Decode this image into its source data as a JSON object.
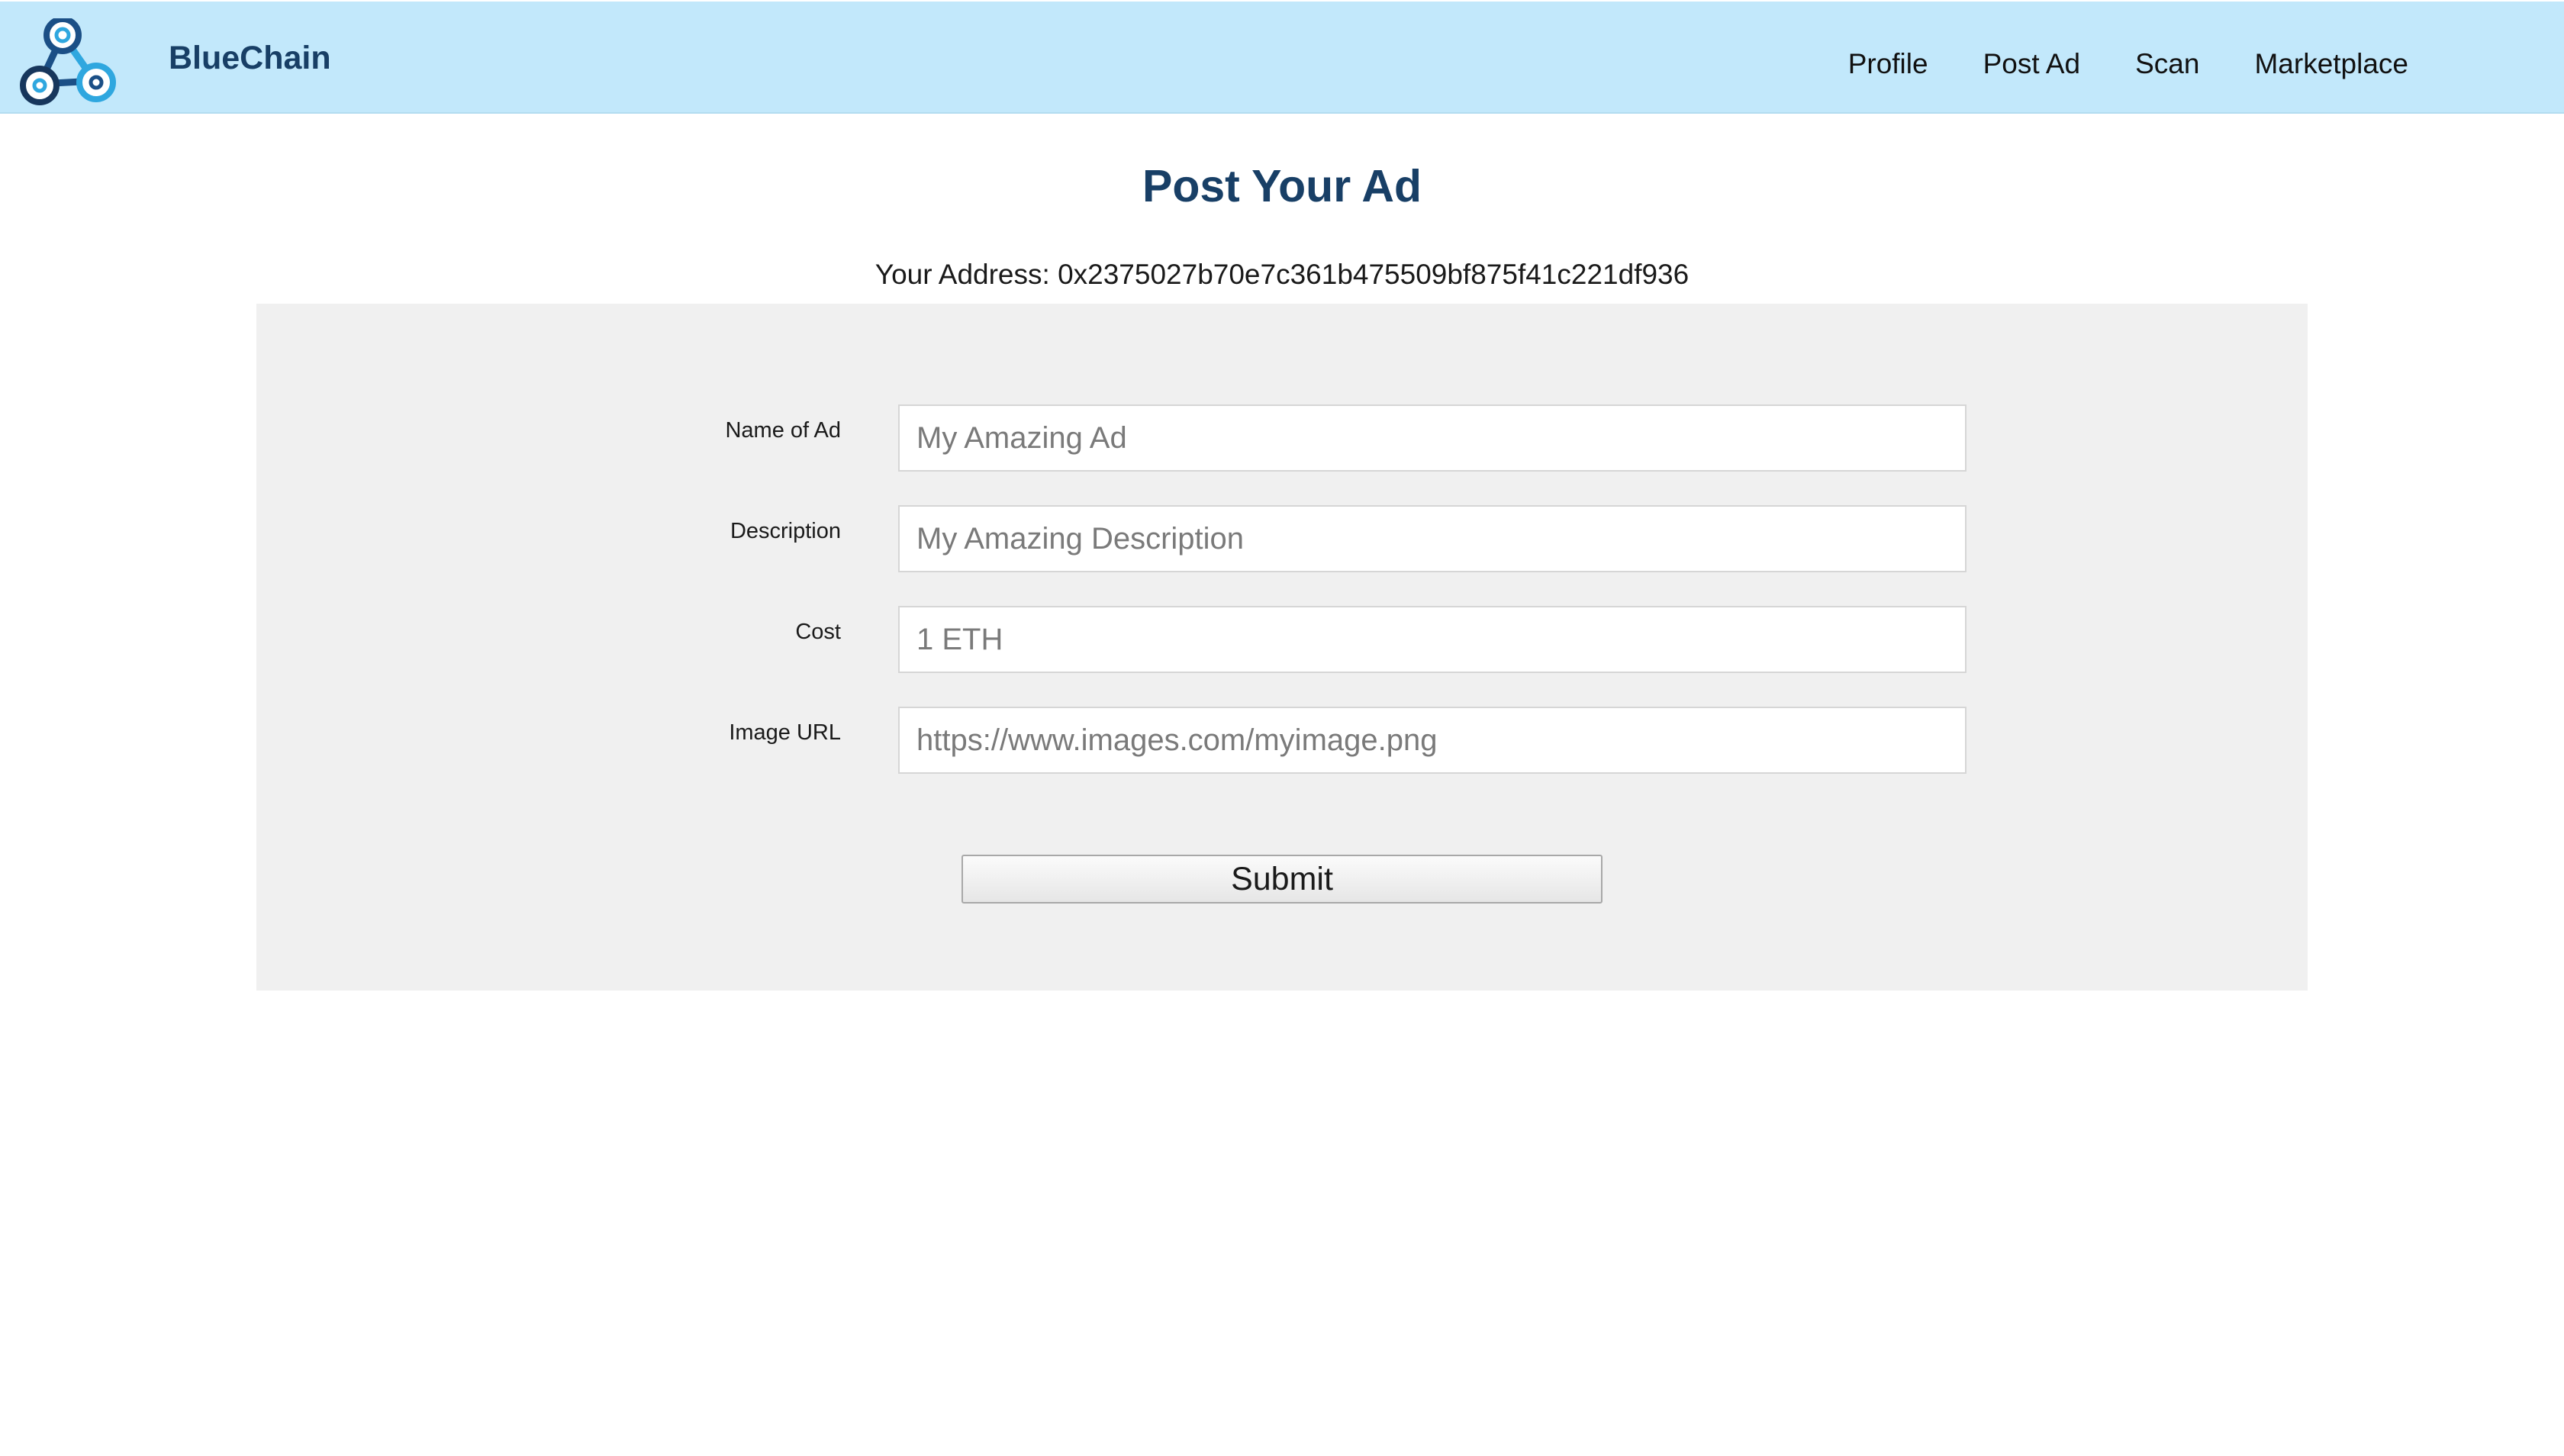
{
  "navbar": {
    "brand": "BlueChain",
    "logo_icon": "bluechain-logo-icon",
    "links": [
      {
        "label": "Profile"
      },
      {
        "label": "Post Ad"
      },
      {
        "label": "Scan"
      },
      {
        "label": "Marketplace"
      }
    ]
  },
  "page": {
    "title": "Post Your Ad",
    "address_label": "Your Address: 0x2375027b70e7c361b475509bf875f41c221df936"
  },
  "form": {
    "fields": [
      {
        "label": "Name of Ad",
        "placeholder": "My Amazing Ad",
        "value": ""
      },
      {
        "label": "Description",
        "placeholder": "My Amazing Description",
        "value": ""
      },
      {
        "label": "Cost",
        "placeholder": "1 ETH",
        "value": ""
      },
      {
        "label": "Image URL",
        "placeholder": "https://www.images.com/myimage.png",
        "value": ""
      }
    ],
    "submit_label": "Submit"
  },
  "colors": {
    "navbar_bg": "#c2e8fb",
    "brand": "#183f66",
    "panel_bg": "#f0f0f0"
  }
}
